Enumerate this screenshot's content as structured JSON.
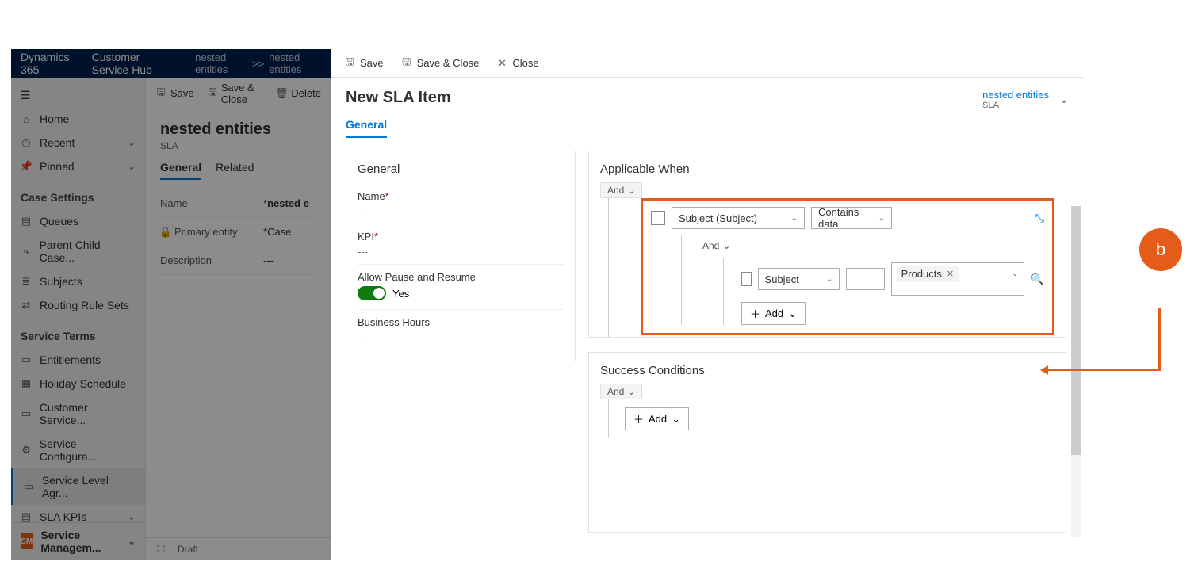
{
  "bg": {
    "brand": "Dynamics 365",
    "hub": "Customer Service Hub",
    "breadcrumb1": "nested entities",
    "breadcrumb2": "nested entities",
    "cmd_save": "Save",
    "cmd_save_close": "Save & Close",
    "cmd_delete": "Delete",
    "title": "nested entities",
    "subtitle": "SLA",
    "tab_general": "General",
    "tab_related": "Related",
    "form": {
      "name_lbl": "Name",
      "name_val": "nested e",
      "primary_lbl": "Primary entity",
      "primary_val": "Case",
      "desc_lbl": "Description",
      "desc_val": "---"
    },
    "nav": {
      "home": "Home",
      "recent": "Recent",
      "pinned": "Pinned",
      "case_settings": "Case Settings",
      "queues": "Queues",
      "parent_child": "Parent Child Case...",
      "subjects": "Subjects",
      "routing": "Routing Rule Sets",
      "service_terms": "Service Terms",
      "entitlements": "Entitlements",
      "holiday": "Holiday Schedule",
      "customer_service": "Customer Service...",
      "service_config": "Service Configura...",
      "sla": "Service Level Agr...",
      "sla_kpis": "SLA KPIs",
      "service_mgmt": "Service Managem...",
      "sm_badge": "SM"
    },
    "footer_status": "Draft"
  },
  "fg": {
    "cmd_save": "Save",
    "cmd_save_close": "Save & Close",
    "cmd_close": "Close",
    "title": "New SLA Item",
    "head_name": "nested entities",
    "head_sub": "SLA",
    "tab_general": "General",
    "general_section": {
      "title": "General",
      "name_lbl": "Name",
      "name_val": "---",
      "kpi_lbl": "KPI",
      "kpi_val": "---",
      "allow_lbl": "Allow Pause and Resume",
      "allow_val": "Yes",
      "hours_lbl": "Business Hours",
      "hours_val": "---"
    },
    "applicable": {
      "title": "Applicable When",
      "and": "And",
      "field1": "Subject (Subject)",
      "op1": "Contains data",
      "nested_and": "And",
      "field2": "Subject",
      "tag": "Products",
      "add": "Add"
    },
    "success": {
      "title": "Success Conditions",
      "and": "And",
      "add": "Add"
    }
  },
  "callout": {
    "label": "b"
  }
}
